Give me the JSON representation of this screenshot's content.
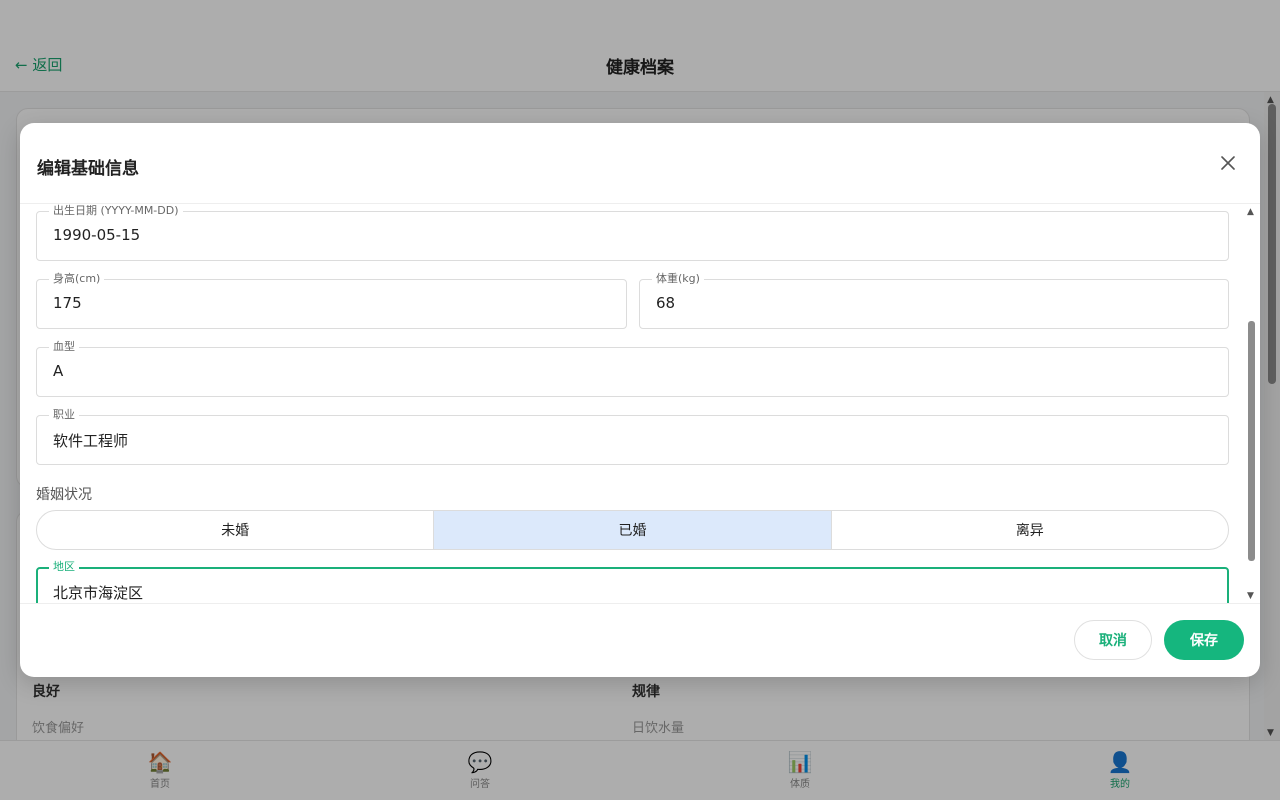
{
  "header": {
    "back_label": "← 返回",
    "title": "健康档案"
  },
  "background": {
    "row1": {
      "left_value": "良好",
      "right_value": "规律"
    },
    "row2": {
      "left_key": "饮食偏好",
      "right_key": "日饮水量"
    }
  },
  "bottom_nav": {
    "items": [
      {
        "label": "首页",
        "icon": "home-icon"
      },
      {
        "label": "问答",
        "icon": "chat-bubble-icon"
      },
      {
        "label": "体质",
        "icon": "bar-chart-icon"
      },
      {
        "label": "我的",
        "icon": "user-icon"
      }
    ],
    "active": "我的"
  },
  "dialog": {
    "title": "编辑基础信息",
    "fields": {
      "birthdate": {
        "label": "出生日期 (YYYY-MM-DD)",
        "value": "1990-05-15"
      },
      "height": {
        "label": "身高(cm)",
        "value": "175"
      },
      "weight": {
        "label": "体重(kg)",
        "value": "68"
      },
      "blood_type": {
        "label": "血型",
        "value": "A"
      },
      "occupation": {
        "label": "职业",
        "value": "软件工程师"
      },
      "region": {
        "label": "地区",
        "value": "北京市海淀区"
      }
    },
    "marital": {
      "label": "婚姻状况",
      "options": [
        "未婚",
        "已婚",
        "离异"
      ],
      "selected": "已婚"
    },
    "cancel_label": "取消",
    "save_label": "保存"
  },
  "colors": {
    "accent": "#15b67e",
    "selected_segment": "#dce9fb"
  }
}
